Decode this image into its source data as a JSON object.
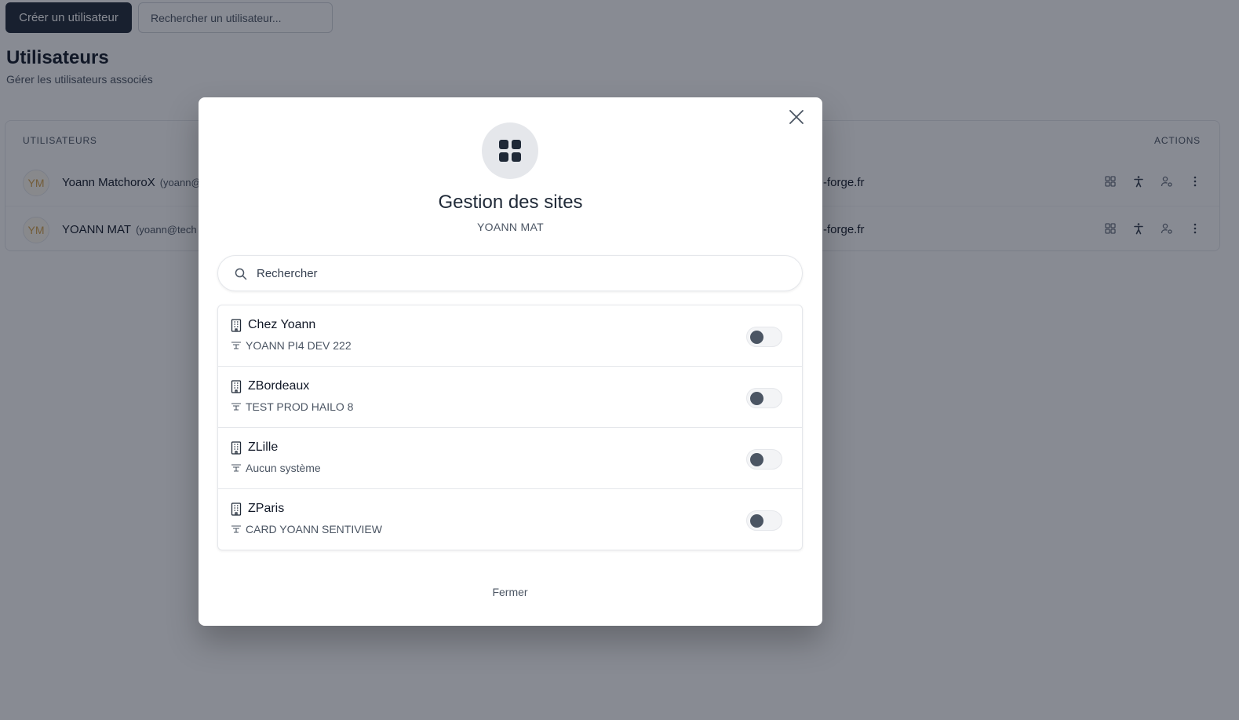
{
  "toolbar": {
    "create_user_label": "Créer un utilisateur",
    "search_placeholder": "Rechercher un utilisateur..."
  },
  "page": {
    "title": "Utilisateurs",
    "subtitle": "Gérer les utilisateurs associés"
  },
  "users_table": {
    "headers": {
      "users": "UTILISATEURS",
      "actions": "ACTIONS"
    },
    "rows": [
      {
        "initials": "YM",
        "name": "Yoann MatchoroX",
        "email": "(yoann@",
        "domain": "-forge.fr"
      },
      {
        "initials": "YM",
        "name": "YOANN MAT",
        "email": "(yoann@tech",
        "domain": "-forge.fr"
      }
    ],
    "action_icons": [
      "grid-icon",
      "accessibility-icon",
      "user-settings-icon",
      "more-vertical-icon"
    ]
  },
  "modal": {
    "icon": "grid-icon",
    "title": "Gestion des sites",
    "subtitle": "YOANN MAT",
    "search_placeholder": "Rechercher",
    "sites": [
      {
        "name": "Chez Yoann",
        "system": "YOANN PI4 DEV 222",
        "enabled": false
      },
      {
        "name": "ZBordeaux",
        "system": "TEST PROD HAILO 8",
        "enabled": false
      },
      {
        "name": "ZLille",
        "system": "Aucun système",
        "enabled": false
      },
      {
        "name": "ZParis",
        "system": "CARD YOANN SENTIVIEW",
        "enabled": false
      }
    ],
    "close_label": "Fermer"
  },
  "colors": {
    "primary": "#1f2937",
    "overlay": "rgba(17,24,39,0.5)",
    "avatar_text": "#d4a24c"
  }
}
